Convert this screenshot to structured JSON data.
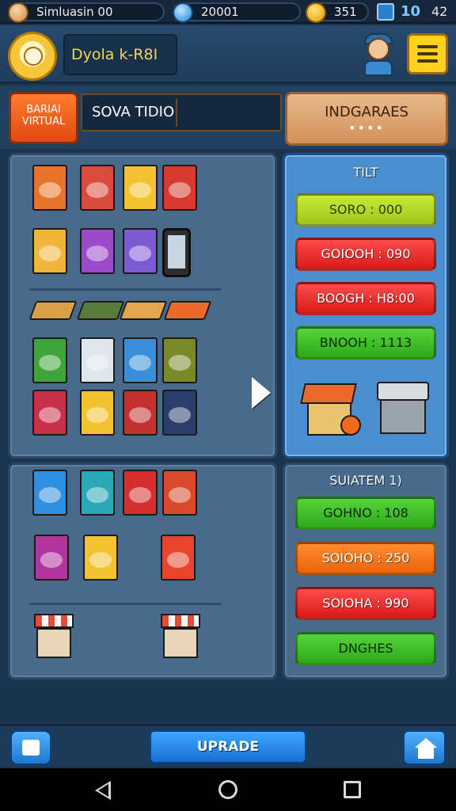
{
  "status_bar": {
    "player_name": "Simluasin 00",
    "gems": "20001",
    "coins": "351",
    "level": "10",
    "extra": "42"
  },
  "header": {
    "title": "Dyola k-R8I"
  },
  "tabs": {
    "virtual_label": "BARIAI VIRTUAL",
    "search_text": "SOVA TIDIO",
    "right_title": "INDGARAES",
    "right_dots": "••••"
  },
  "inventory": {
    "row1": [
      {
        "name": "cereal-box-icon",
        "color": "#e8732a"
      },
      {
        "name": "shopping-bag-icon",
        "color": "#d94b3c"
      },
      {
        "name": "snack-box-icon",
        "color": "#f2c230"
      },
      {
        "name": "juice-box-icon",
        "color": "#d63a2f"
      }
    ],
    "row2": [
      {
        "name": "fruit-stand-icon",
        "color": "#f0b53a"
      },
      {
        "name": "purple-box-icon",
        "color": "#9b4ac9"
      },
      {
        "name": "storefront-icon",
        "color": "#7e5ad0"
      },
      {
        "name": "phone-icon",
        "color": "#2e2e2e"
      }
    ],
    "row3": [
      {
        "name": "tray-icon",
        "color": "#d9a24a"
      },
      {
        "name": "veggie-tray-icon",
        "color": "#5a7a3a"
      },
      {
        "name": "bread-tray-icon",
        "color": "#e2a64e"
      },
      {
        "name": "orange-pad-icon",
        "color": "#ef6a2a"
      }
    ],
    "row4": [
      {
        "name": "green-box-icon",
        "color": "#3fa43a"
      },
      {
        "name": "milk-box-icon",
        "color": "#dfe6ee"
      },
      {
        "name": "blue-box-icon",
        "color": "#3a8fd8"
      },
      {
        "name": "olive-box-icon",
        "color": "#7a8a2a"
      }
    ],
    "row5": [
      {
        "name": "red-cereal-icon",
        "color": "#c8304a"
      },
      {
        "name": "yellow-box-icon",
        "color": "#f2c230"
      },
      {
        "name": "tomato-box-icon",
        "color": "#c43030"
      },
      {
        "name": "dark-box-icon",
        "color": "#2b3f6a"
      }
    ]
  },
  "inventory2": {
    "row1": [
      {
        "name": "blue-cereal-icon",
        "color": "#2f8fe0"
      },
      {
        "name": "teal-box-icon",
        "color": "#2aa8b8"
      },
      {
        "name": "red-pack-icon",
        "color": "#d62f2f"
      },
      {
        "name": "market-stand-icon",
        "color": "#d84a2a"
      }
    ],
    "row2": [
      {
        "name": "magenta-box-icon",
        "color": "#b0359c"
      },
      {
        "name": "sale-bag-icon",
        "color": "#f2c230"
      },
      {
        "name": "orange-cereal-icon",
        "color": "#e8452f"
      }
    ],
    "row3": [
      {
        "name": "kiosk-icon",
        "color": "#e84a3a"
      },
      {
        "name": "awning-stall-icon",
        "color": "#e84a3a"
      }
    ]
  },
  "side_panel_1": {
    "title": "TILT",
    "options": [
      {
        "label": "SORO : 000",
        "style": "lime"
      },
      {
        "label": "GOIOOH : 090",
        "style": "red"
      },
      {
        "label": "BOOGH : H8:00",
        "style": "red"
      },
      {
        "label": "BNOOH : 1113",
        "style": "green"
      }
    ]
  },
  "side_panel_2": {
    "title": "SUIATEM 1)",
    "options": [
      {
        "label": "GOHNO : 108",
        "style": "green"
      },
      {
        "label": "SOIOHO : 250",
        "style": "orange"
      },
      {
        "label": "SOIOHA : 990",
        "style": "red"
      },
      {
        "label": "DNGHES",
        "style": "green"
      }
    ]
  },
  "bottom_bar": {
    "upgrade_label": "UPRADE"
  }
}
